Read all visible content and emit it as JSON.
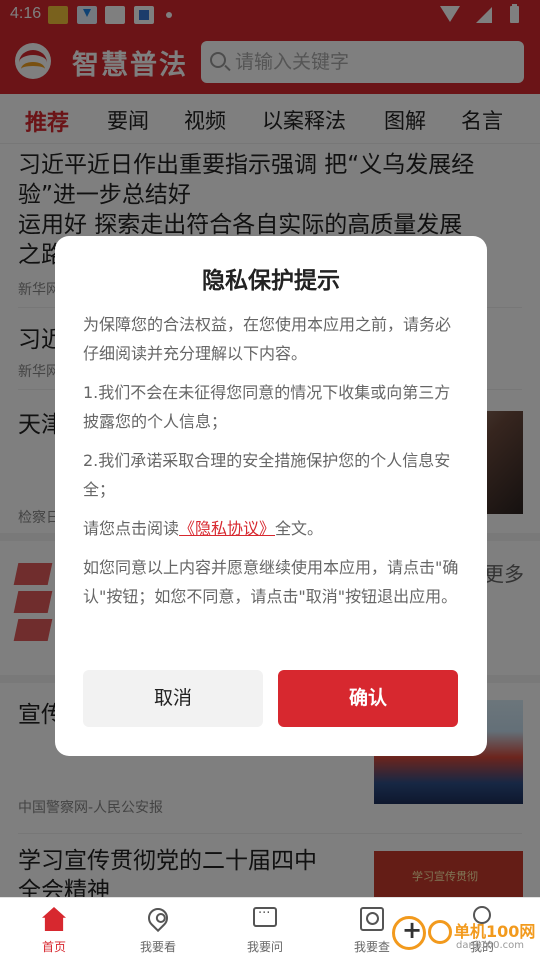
{
  "status_bar": {
    "time": "4:16"
  },
  "header": {
    "app_title": "智慧普法",
    "search_placeholder": "请输入关键字"
  },
  "tabs": [
    "推荐",
    "要闻",
    "视频",
    "以案释法",
    "图解",
    "名言"
  ],
  "feed": {
    "item1_line1": "习近平近日作出重要指示强调 把“义乌发展经",
    "item1_line2": "验”进一步总结好",
    "item1_line3": "运用好 探索走出符合各自实际的高质量发展",
    "item1_line4": "之路",
    "item1_source": "新华网",
    "item2_title": "习近",
    "item2_source": "新华网",
    "item3_title": "天津",
    "item3_source": "检察日",
    "more_link": "更多",
    "item4_title": "宣传",
    "item4_source": "中国警察网-人民公安报",
    "item5_line1": "学习宣传贯彻党的二十届四中",
    "item5_line2": "全会精神",
    "item5_thumb_text": "学习宣传贯彻"
  },
  "dialog": {
    "title": "隐私保护提示",
    "intro": "为保障您的合法权益，在您使用本应用之前，请务必仔细阅读并充分理解以下内容。",
    "point1": "1.我们不会在未征得您同意的情况下收集或向第三方披露您的个人信息；",
    "point2": "2.我们承诺采取合理的安全措施保护您的个人信息安全；",
    "read_prefix": "请您点击阅读",
    "privacy_link": "《隐私协议》",
    "read_suffix": "全文。",
    "consent": "如您同意以上内容并愿意继续使用本应用，请点击\"确认\"按钮；如您不同意，请点击\"取消\"按钮退出应用。",
    "cancel_label": "取消",
    "confirm_label": "确认"
  },
  "bottom_nav": [
    "首页",
    "我要看",
    "我要问",
    "我要查",
    "我的"
  ],
  "watermark": {
    "brand": "单机100网",
    "url": "danji100.com"
  },
  "colors": {
    "brand_red": "#d7282f",
    "overlay": "rgba(0,0,0,0.5)"
  }
}
